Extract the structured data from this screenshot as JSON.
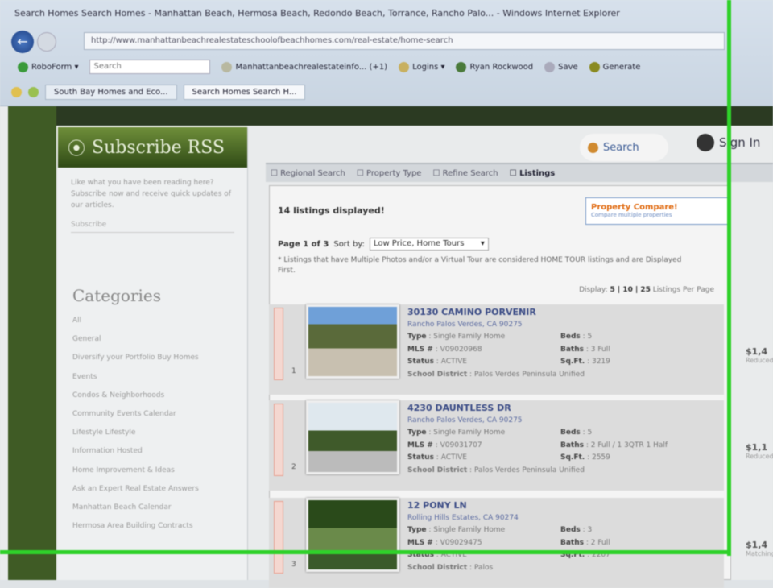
{
  "browser": {
    "title": "Search Homes Search Homes - Manhattan Beach, Hermosa Beach, Redondo Beach, Torrance, Rancho Palo... - Windows Internet Explorer",
    "url": "http://www.manhattanbeachrealestateschoolofbeachhomes.com/real-estate/home-search",
    "toolbar": [
      {
        "label": "RoboForm ▾"
      },
      {
        "label": "Search",
        "placeholder": true
      },
      {
        "label": "Manhattanbeachrealestateinfo... (+1)"
      },
      {
        "label": "Logins ▾"
      },
      {
        "label": "Ryan Rockwood"
      },
      {
        "label": "Save"
      },
      {
        "label": "Generate"
      }
    ],
    "tabs": [
      {
        "label": "South Bay Homes and Eco..."
      },
      {
        "label": "Search Homes Search H..."
      }
    ]
  },
  "sidebar": {
    "rss_title": "Subscribe RSS",
    "rss_text": "Like what you have been reading here? Subscribe now and receive quick updates of our articles.",
    "rss_link": "Subscribe",
    "categories_title": "Categories",
    "categories": [
      "All",
      "General",
      "Diversify your Portfolio Buy Homes",
      "Events",
      "Condos & Neighborhoods",
      "Community Events Calendar",
      "Lifestyle Lifestyle",
      "Information Hosted",
      "Home Improvement & Ideas",
      "Ask an Expert Real Estate Answers",
      "Manhattan Beach Calendar",
      "Hermosa Area Building Contracts"
    ]
  },
  "main": {
    "search_button": "Search",
    "signin_button": "Sign In",
    "steps": [
      "Regional Search",
      "Property Type",
      "Refine Search",
      "Listings"
    ],
    "count": "14 listings displayed!",
    "compare": "Property Compare!",
    "compare_sub": "Compare multiple properties",
    "page_label": "Page 1 of 3",
    "sort_label": "Sort by:",
    "sort_value": "Low Price, Home Tours",
    "note": "* Listings that have Multiple Photos and/or a Virtual Tour are considered HOME TOUR listings and are Displayed First.",
    "display_label": "Display:",
    "display_options": "5 | 10 | 25",
    "display_suffix": "Listings Per Page"
  },
  "listings": [
    {
      "num": "1",
      "address": "30130 CAMINO PORVENIR",
      "city": "Rancho Palos Verdes, CA 90275",
      "type": "Single Family Home",
      "mls": "V09020968",
      "status": "ACTIVE",
      "beds": "5",
      "baths": "3 Full",
      "sqft": "3219",
      "school": "Palos Verdes Peninsula Unified",
      "price": "$1,4",
      "price_note": "Reduced"
    },
    {
      "num": "2",
      "address": "4230 DAUNTLESS DR",
      "city": "Rancho Palos Verdes, CA 90275",
      "type": "Single Family Home",
      "mls": "V09031707",
      "status": "ACTIVE",
      "beds": "5",
      "baths": "2 Full / 1 3QTR 1 Half",
      "sqft": "2559",
      "school": "Palos Verdes Peninsula Unified",
      "price": "$1,1",
      "price_note": "Reduced"
    },
    {
      "num": "3",
      "address": "12 PONY LN",
      "city": "Rolling Hills Estates, CA 90274",
      "type": "Single Family Home",
      "mls": "V09029475",
      "status": "ACTIVE",
      "beds": "3",
      "baths": "2 Full",
      "sqft": "2207",
      "school": "Palos",
      "price": "$1,4",
      "price_note": "Matching"
    }
  ],
  "labels": {
    "type": "Type",
    "mls": "MLS #",
    "status": "Status",
    "beds": "Beds",
    "baths": "Baths",
    "sqft": "Sq.Ft.",
    "school": "School District"
  },
  "colors": {
    "overlay": "#2fd12a",
    "rss_green": "#4f6f2a",
    "link_blue": "#3b4c86"
  }
}
